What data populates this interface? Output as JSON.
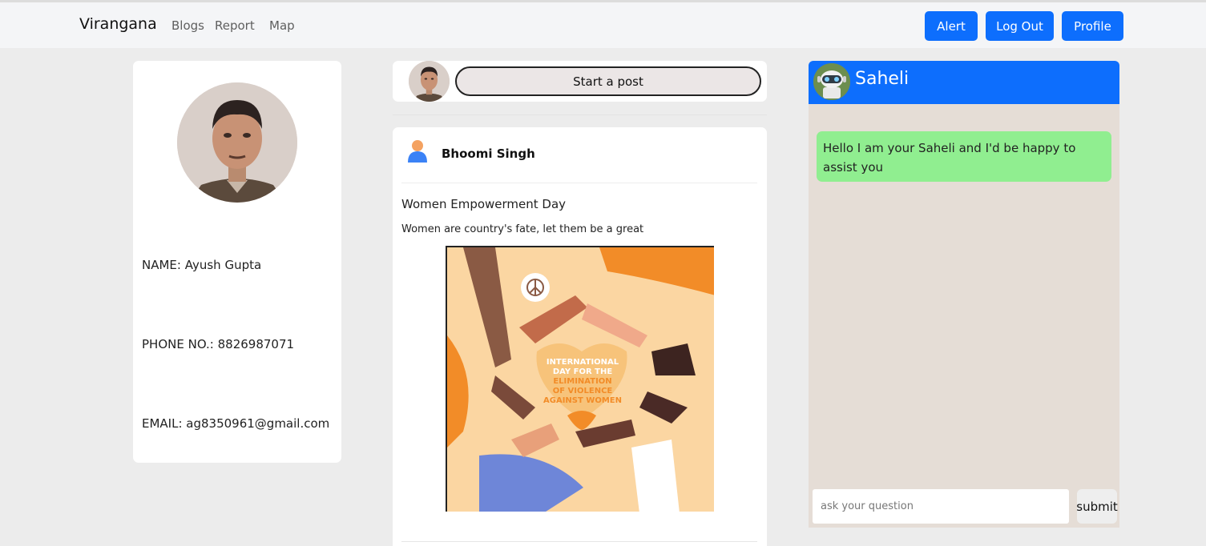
{
  "navbar": {
    "brand": "Virangana",
    "links": [
      "Blogs",
      "Report",
      "Map"
    ],
    "buttons": [
      "Alert",
      "Log Out",
      "Profile"
    ],
    "accent": "#0d6efd"
  },
  "profile": {
    "name": "NAME: Ayush Gupta",
    "phone": "PHONE NO.: 8826987071",
    "email": "EMAIL: ag8350961@gmail.com"
  },
  "composer": {
    "start_post_label": "Start a post"
  },
  "post": {
    "author": "Bhoomi Singh",
    "title": "Women Empowerment Day",
    "body": "Women are country's fate, let them be a great",
    "image_text": {
      "line1": "INTERNATIONAL",
      "line2": "DAY FOR THE",
      "line3": "ELIMINATION",
      "line4": "OF VIOLENCE",
      "line5": "AGAINST WOMEN"
    }
  },
  "chat": {
    "title": "Saheli",
    "welcome": "Hello I am your Saheli and I'd be happy to assist you",
    "input_placeholder": "ask your question",
    "submit_label": "submit",
    "header_color": "#0d6efd",
    "bubble_color": "#90ee90"
  }
}
